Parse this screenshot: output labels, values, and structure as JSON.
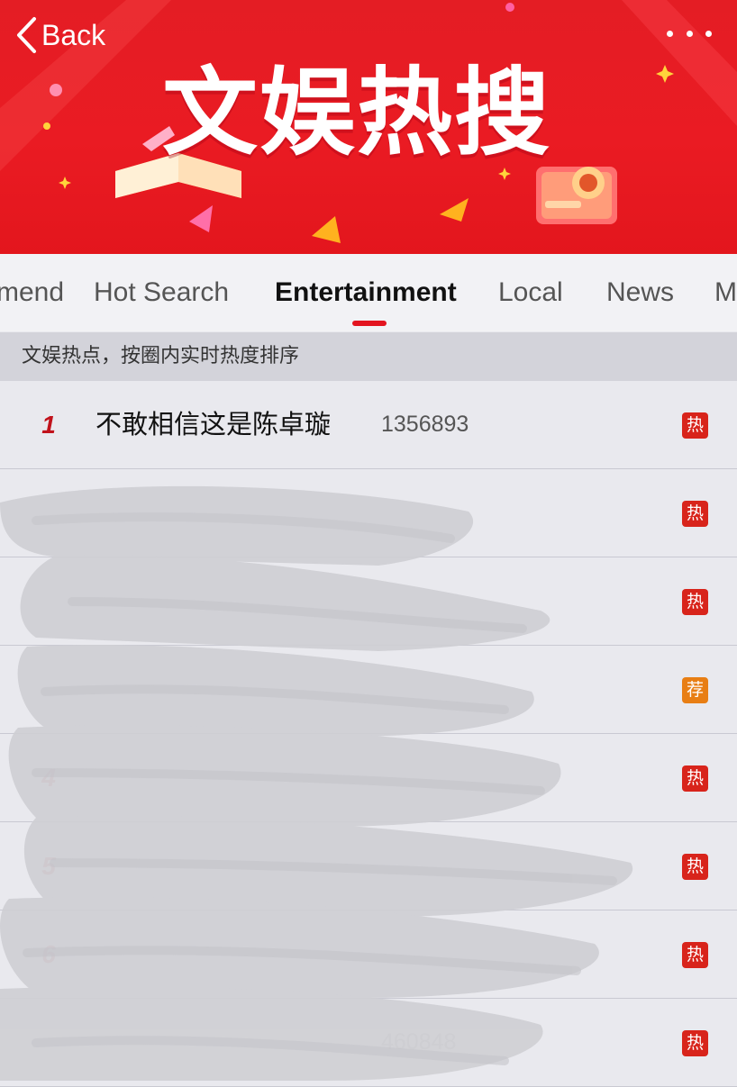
{
  "header": {
    "back_label": "Back",
    "banner_title": "文娱热搜",
    "more_icon": "more-dots-icon"
  },
  "tabs": [
    {
      "label": "mend",
      "active": false
    },
    {
      "label": "Hot Search",
      "active": false
    },
    {
      "label": "Entertainment",
      "active": true
    },
    {
      "label": "Local",
      "active": false
    },
    {
      "label": "News",
      "active": false
    },
    {
      "label": "M",
      "active": false
    }
  ],
  "subtitle": "文娱热点，按圈内实时热度排序",
  "colors": {
    "brand_red": "#e41d24",
    "hot_badge": "#d8241b",
    "recommend_badge": "#e87e14",
    "rank_color": "#c1121b"
  },
  "list": {
    "rows": [
      {
        "rank": "1",
        "title": "不敢相信这是陈卓璇",
        "count": "1356893",
        "badge": "热",
        "badge_type": "hot",
        "obscured": false
      },
      {
        "rank": "",
        "title": "",
        "count": "",
        "badge": "热",
        "badge_type": "hot",
        "obscured": true
      },
      {
        "rank": "",
        "title": "",
        "count": "",
        "badge": "热",
        "badge_type": "hot",
        "obscured": true
      },
      {
        "rank": "",
        "title": "",
        "count": "",
        "badge": "荐",
        "badge_type": "rec",
        "obscured": true
      },
      {
        "rank": "4",
        "title": "",
        "count": "",
        "badge": "热",
        "badge_type": "hot",
        "obscured": true
      },
      {
        "rank": "5",
        "title": "",
        "count": "",
        "badge": "热",
        "badge_type": "hot",
        "obscured": true
      },
      {
        "rank": "6",
        "title": "",
        "count": "",
        "badge": "热",
        "badge_type": "hot",
        "obscured": true
      },
      {
        "rank": "",
        "title": "",
        "count": "460848",
        "badge": "热",
        "badge_type": "hot",
        "obscured": true
      }
    ]
  }
}
